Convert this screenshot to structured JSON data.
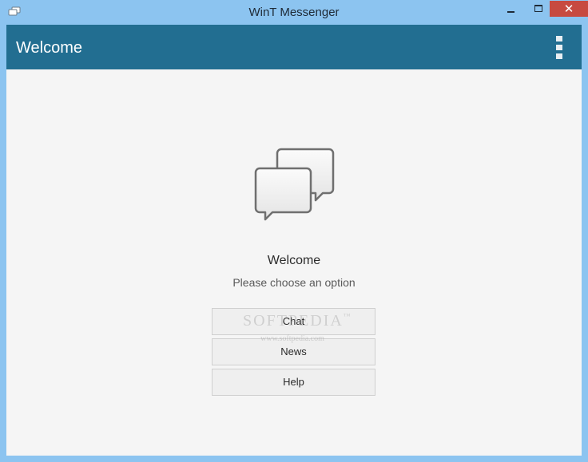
{
  "window": {
    "title": "WinT Messenger",
    "close_glyph": "✕",
    "icons": {
      "app": "chat-bubbles-icon",
      "minimize": "minimize-icon",
      "maximize": "maximize-icon",
      "close": "close-icon"
    },
    "colors": {
      "frame": "#8cc4f0",
      "close": "#c74a40"
    }
  },
  "appbar": {
    "title": "Welcome",
    "menu_icon": "overflow-menu-icon",
    "color": "#226e91"
  },
  "main": {
    "hero_icon": "chat-bubbles-icon",
    "heading": "Welcome",
    "subheading": "Please choose an option",
    "buttons": {
      "chat": "Chat",
      "news": "News",
      "help": "Help"
    },
    "background": "#f5f5f5"
  },
  "watermark": {
    "brand": "SOFTPEDIA",
    "trademark": "™",
    "url": "www.softpedia.com"
  }
}
